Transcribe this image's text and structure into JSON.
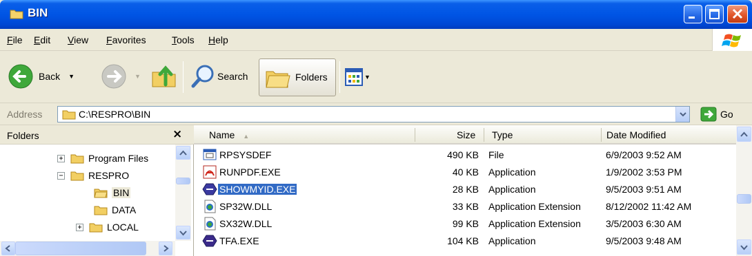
{
  "window": {
    "title": "BIN"
  },
  "menu": [
    {
      "label": "File"
    },
    {
      "label": "Edit"
    },
    {
      "label": "View"
    },
    {
      "label": "Favorites"
    },
    {
      "label": "Tools"
    },
    {
      "label": "Help"
    }
  ],
  "toolbar": {
    "back_label": "Back",
    "search_label": "Search",
    "folders_label": "Folders"
  },
  "address": {
    "label": "Address",
    "value": "C:\\RESPRO\\BIN",
    "go_label": "Go"
  },
  "folders_pane": {
    "title": "Folders",
    "close_glyph": "×",
    "tree": [
      {
        "label": "Program Files",
        "expander": "+",
        "selected": false
      },
      {
        "label": "RESPRO",
        "expander": "−",
        "selected": false
      },
      {
        "label": "BIN",
        "expander": "",
        "selected": true
      },
      {
        "label": "DATA",
        "expander": "",
        "selected": false
      },
      {
        "label": "LOCAL",
        "expander": "+",
        "selected": false
      }
    ]
  },
  "file_list": {
    "columns": {
      "name": "Name",
      "size": "Size",
      "type": "Type",
      "date": "Date Modified"
    },
    "rows": [
      {
        "name": "RPSYSDEF",
        "size": "490 KB",
        "type": "File",
        "date": "6/9/2003 9:52 AM",
        "icon": "system-file-icon",
        "selected": false
      },
      {
        "name": "RUNPDF.EXE",
        "size": "40 KB",
        "type": "Application",
        "date": "1/9/2002 3:53 PM",
        "icon": "pdf-app-icon",
        "selected": false
      },
      {
        "name": "SHOWMYID.EXE",
        "size": "28 KB",
        "type": "Application",
        "date": "9/5/2003 9:51 AM",
        "icon": "app-icon",
        "selected": true
      },
      {
        "name": "SP32W.DLL",
        "size": "33 KB",
        "type": "Application Extension",
        "date": "8/12/2002 11:42 AM",
        "icon": "dll-icon",
        "selected": false
      },
      {
        "name": "SX32W.DLL",
        "size": "99 KB",
        "type": "Application Extension",
        "date": "3/5/2003 6:30 AM",
        "icon": "dll-icon",
        "selected": false
      },
      {
        "name": "TFA.EXE",
        "size": "104 KB",
        "type": "Application",
        "date": "9/5/2003 9:48 AM",
        "icon": "app-icon",
        "selected": false
      }
    ]
  },
  "colors": {
    "titlebar": "#0055e5",
    "selection": "#316ac5",
    "chrome": "#ece9d8",
    "folder": "#f2cf63"
  }
}
